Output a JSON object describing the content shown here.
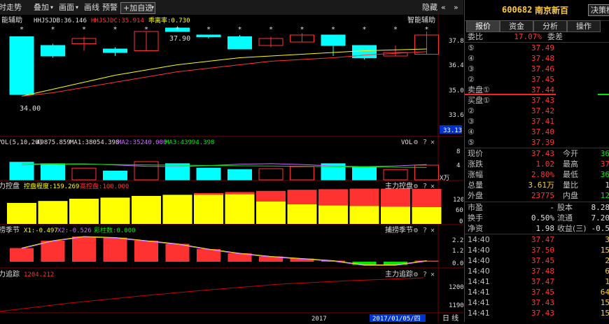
{
  "toolbar": {
    "items": [
      "时走势",
      "叠加",
      "画面",
      "画线",
      "预警"
    ],
    "add_label": "+加自选",
    "hide_label": "隐藏"
  },
  "indicators": {
    "main_title": "智能辅助",
    "hhjs_label": "HHJSJDB:36.146",
    "hhjsjdc_label": "HHJSJDC:35.914",
    "deviation_label": "乖离率:0.730",
    "high_mark": "37.90",
    "low_mark": "34.00",
    "vol_label": "VOL(5,10,20)",
    "vol_value": "49875.859",
    "ma1": "MA1:38054.398",
    "ma2": "MA2:35240.000",
    "ma3": "MA3:43994.398",
    "vol_name": "VOL",
    "vol_unit": "X万",
    "zlkp_title": "主力控盘",
    "zlkp_degree": "控盘程度:159.269",
    "zlkp_high": "高控盘:100.000",
    "bljj_title": "捕捞季节",
    "bljj_x1": "X1:-0.497",
    "bljj_x2": "X2:-0.526",
    "bljj_col": "彩柱数:0.000",
    "zlzz_title": "主力追踪",
    "zlzz_value": "1204.212",
    "date_year": "2017",
    "date_cursor": "2017/01/05/四",
    "corner": "日 线"
  },
  "axes": {
    "main": [
      "37.8",
      "36.4",
      "35.0",
      "33.6",
      "33.13"
    ],
    "vol": [
      "8",
      "4"
    ],
    "zlkp": [
      "120",
      "60",
      "0"
    ],
    "bljj": [
      "2.2",
      "1.2",
      "0.0"
    ],
    "zlzz": [
      "1200",
      "1190"
    ]
  },
  "chart_data": {
    "type": "candlestick",
    "candles": [
      {
        "o": 37.3,
        "c": 34.0,
        "h": 37.3,
        "l": 34.0,
        "up": false
      },
      {
        "o": 36.8,
        "c": 36.2,
        "h": 36.9,
        "l": 36.1,
        "up": false
      },
      {
        "o": 36.9,
        "c": 37.2,
        "h": 37.3,
        "l": 36.5,
        "up": true
      },
      {
        "o": 36.6,
        "c": 36.4,
        "h": 36.7,
        "l": 36.2,
        "up": false
      },
      {
        "o": 36.5,
        "c": 37.6,
        "h": 37.6,
        "l": 36.5,
        "up": true
      },
      {
        "o": 37.8,
        "c": 37.6,
        "h": 37.9,
        "l": 37.6,
        "up": false
      },
      {
        "o": 37.4,
        "c": 37.3,
        "h": 37.4,
        "l": 37.2,
        "up": false
      },
      {
        "o": 37.3,
        "c": 36.6,
        "h": 37.4,
        "l": 36.6,
        "up": false
      },
      {
        "o": 36.8,
        "c": 37.2,
        "h": 37.3,
        "l": 36.7,
        "up": true
      },
      {
        "o": 37.0,
        "c": 37.4,
        "h": 37.5,
        "l": 37.0,
        "up": true
      },
      {
        "o": 37.4,
        "c": 36.8,
        "h": 37.4,
        "l": 36.2,
        "up": false
      },
      {
        "o": 36.8,
        "c": 36.1,
        "h": 36.8,
        "l": 36.0,
        "up": false
      },
      {
        "o": 36.2,
        "c": 36.4,
        "h": 36.8,
        "l": 36.2,
        "up": true
      },
      {
        "o": 36.3,
        "c": 37.4,
        "h": 37.6,
        "l": 36.3,
        "up": true
      }
    ],
    "volume": [
      {
        "v": 0.6,
        "up": false
      },
      {
        "v": 0.55,
        "up": false
      },
      {
        "v": 0.4,
        "up": true
      },
      {
        "v": 0.3,
        "up": false
      },
      {
        "v": 0.62,
        "up": true
      },
      {
        "v": 0.55,
        "up": false
      },
      {
        "v": 0.4,
        "up": false
      },
      {
        "v": 0.35,
        "up": false
      },
      {
        "v": 0.38,
        "up": true
      },
      {
        "v": 0.45,
        "up": true
      },
      {
        "v": 0.55,
        "up": false
      },
      {
        "v": 0.45,
        "up": false
      },
      {
        "v": 0.35,
        "up": true
      },
      {
        "v": 0.5,
        "up": true
      }
    ],
    "control": [
      {
        "total": 75,
        "yellow": 75
      },
      {
        "total": 82,
        "yellow": 82
      },
      {
        "total": 90,
        "yellow": 90
      },
      {
        "total": 94,
        "yellow": 94
      },
      {
        "total": 100,
        "yellow": 100
      },
      {
        "total": 104,
        "yellow": 104
      },
      {
        "total": 110,
        "yellow": 104
      },
      {
        "total": 114,
        "yellow": 106
      },
      {
        "total": 118,
        "yellow": 80
      },
      {
        "total": 122,
        "yellow": 70
      },
      {
        "total": 124,
        "yellow": 66
      },
      {
        "total": 126,
        "yellow": 64
      },
      {
        "total": 126,
        "yellow": 62
      },
      {
        "total": 125,
        "yellow": 60
      }
    ],
    "season": [
      1.3,
      2.0,
      2.4,
      2.3,
      2.0,
      1.7,
      1.2,
      0.8,
      0.5,
      0.3,
      0.1,
      -0.3,
      -0.3,
      0.1
    ],
    "ma_yellow": [
      33.9,
      34.3,
      34.7,
      35.1,
      35.4,
      35.7,
      35.9,
      36.1,
      36.2,
      36.3,
      36.4,
      36.5,
      36.55,
      36.6
    ],
    "ma_red": [
      33.9,
      34.1,
      34.4,
      34.7,
      35.0,
      35.3,
      35.5,
      35.7,
      35.9,
      36.0,
      36.1,
      36.25,
      36.35,
      36.45
    ],
    "colors": {
      "up": "#ff3232",
      "down": "#00ffff",
      "yellow": "#ffff00",
      "green": "#00e600"
    }
  },
  "quote": {
    "code": "600682",
    "name": "南京新百",
    "decision_btn": "决策框",
    "tabs": [
      "报价",
      "资金",
      "分析",
      "操作"
    ],
    "weibi_label": "委比",
    "weibi_value": "17.07%",
    "weicha_label": "委差",
    "sell": [
      {
        "label": "⑤",
        "price": "37.49"
      },
      {
        "label": "④",
        "price": "37.48"
      },
      {
        "label": "③",
        "price": "37.46"
      },
      {
        "label": "②",
        "price": "37.45"
      },
      {
        "label": "卖盘①",
        "price": "37.44"
      }
    ],
    "buy": [
      {
        "label": "买盘①",
        "price": "37.43"
      },
      {
        "label": "②",
        "price": "37.42"
      },
      {
        "label": "③",
        "price": "37.41"
      },
      {
        "label": "④",
        "price": "37.40"
      },
      {
        "label": "⑤",
        "price": "37.39"
      }
    ],
    "stats": [
      {
        "l1": "现价",
        "v1": "37.43",
        "c1": "red",
        "l2": "今开",
        "v2": "36",
        "c2": "green"
      },
      {
        "l1": "涨跌",
        "v1": "1.02",
        "c1": "red",
        "l2": "最高",
        "v2": "37",
        "c2": "red"
      },
      {
        "l1": "涨幅",
        "v1": "2.80%",
        "c1": "red",
        "l2": "最低",
        "v2": "36",
        "c2": "green"
      },
      {
        "l1": "总量",
        "v1": "3.61万",
        "c1": "yel",
        "l2": "量比",
        "v2": "1",
        "c2": "wht"
      },
      {
        "l1": "外盘",
        "v1": "23775",
        "c1": "red",
        "l2": "内盘",
        "v2": "12",
        "c2": "green"
      }
    ],
    "stats2": [
      {
        "l1": "市盈",
        "v1": "-",
        "l2": "股本",
        "v2": "8.28"
      },
      {
        "l1": "换手",
        "v1": "0.50%",
        "l2": "流通",
        "v2": "7.20"
      },
      {
        "l1": "净资",
        "v1": "1.98",
        "l2": "收益(三)",
        "v2": "-0.5"
      }
    ],
    "ticks": [
      {
        "time": "14:40",
        "price": "37.47",
        "vol": "3"
      },
      {
        "time": "14:40",
        "price": "37.50",
        "vol": "15"
      },
      {
        "time": "14:40",
        "price": "37.45",
        "vol": "2"
      },
      {
        "time": "14:40",
        "price": "37.48",
        "vol": "6"
      },
      {
        "time": "14:41",
        "price": "37.47",
        "vol": "1"
      },
      {
        "time": "14:41",
        "price": "37.45",
        "vol": "64"
      },
      {
        "time": "14:41",
        "price": "37.43",
        "vol": "15"
      },
      {
        "time": "14:41",
        "price": "37.43",
        "vol": "15"
      }
    ]
  }
}
